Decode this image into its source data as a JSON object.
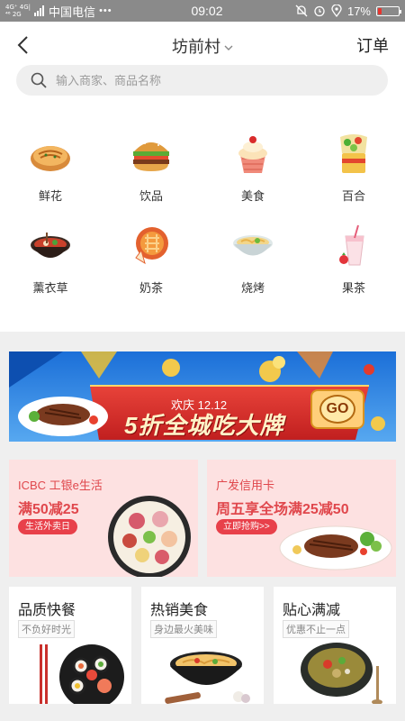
{
  "status_bar": {
    "signal_top": "4G⁺ 4G|",
    "signal_bottom": "⁴⁶ 2G",
    "carrier": "中国电信",
    "dots": "•••",
    "time": "09:02",
    "battery_text": "17%",
    "battery_level": 0.17,
    "battery_color": "#e8342e"
  },
  "header": {
    "title": "坊前村",
    "orders_label": "订单"
  },
  "search": {
    "placeholder": "输入商家、商品名称"
  },
  "categories": [
    {
      "label": "鲜花",
      "icon": "pancake-icon"
    },
    {
      "label": "饮品",
      "icon": "burger-icon"
    },
    {
      "label": "美食",
      "icon": "cupcake-icon"
    },
    {
      "label": "百合",
      "icon": "wrap-icon"
    },
    {
      "label": "薰衣草",
      "icon": "hotpot-icon"
    },
    {
      "label": "奶茶",
      "icon": "pie-icon"
    },
    {
      "label": "烧烤",
      "icon": "noodle-bowl-icon"
    },
    {
      "label": "果茶",
      "icon": "milkshake-icon"
    }
  ],
  "banner": {
    "subtitle": "欢庆 12.12",
    "headline": "5折全城吃大牌",
    "go_label": "GO"
  },
  "promos": [
    {
      "title": "ICBC 工银e生活",
      "offer": "满50减25",
      "button": "生活外卖日"
    },
    {
      "title": "广发信用卡",
      "offer": "周五享全场满25减50",
      "button": "立即抢购>>"
    }
  ],
  "cards": [
    {
      "title": "品质快餐",
      "subtitle": "不负好时光"
    },
    {
      "title": "热销美食",
      "subtitle": "身边最火美味"
    },
    {
      "title": "贴心满减",
      "subtitle": "优惠不止一点"
    }
  ],
  "colors": {
    "accent_red": "#e0474c",
    "promo_bg": "#fde1e1",
    "banner_blue": "#2d7fe0"
  }
}
